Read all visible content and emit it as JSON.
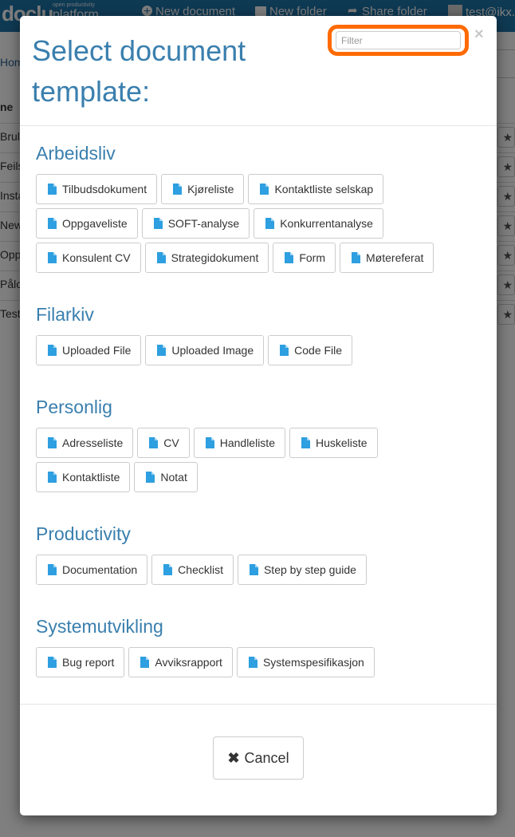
{
  "background": {
    "logo": "doclu",
    "logo_tagline": "open productivity",
    "logo_tagline2": "platform",
    "nav": {
      "new_document": "New document",
      "new_folder": "New folder",
      "share_folder": "Share folder",
      "user": "test@ikx..."
    },
    "breadcrumb": "Home",
    "column_header": "ne",
    "rows": [
      "Brul",
      "Feils",
      "Insta",
      "New",
      "Opp",
      "Pålo",
      "Test"
    ],
    "star": "★"
  },
  "modal": {
    "title": "Select document template:",
    "filter_placeholder": "Filter",
    "close_label": "×",
    "sections": [
      {
        "title": "Arbeidsliv",
        "templates": [
          "Tilbudsdokument",
          "Kjøreliste",
          "Kontaktliste selskap",
          "Oppgaveliste",
          "SOFT-analyse",
          "Konkurrentanalyse",
          "Konsulent CV",
          "Strategidokument",
          "Form",
          "Møtereferat"
        ]
      },
      {
        "title": "Filarkiv",
        "templates": [
          "Uploaded File",
          "Uploaded Image",
          "Code File"
        ]
      },
      {
        "title": "Personlig",
        "templates": [
          "Adresseliste",
          "CV",
          "Handleliste",
          "Huskeliste",
          "Kontaktliste",
          "Notat"
        ]
      },
      {
        "title": "Productivity",
        "templates": [
          "Documentation",
          "Checklist",
          "Step by step guide"
        ]
      },
      {
        "title": "Systemutvikling",
        "templates": [
          "Bug report",
          "Avviksrapport",
          "Systemspesifikasjon"
        ]
      }
    ],
    "cancel_label": "Cancel",
    "cancel_icon": "✖",
    "icon_color": "#2e9fe0",
    "highlight_color": "#ff6a00"
  }
}
